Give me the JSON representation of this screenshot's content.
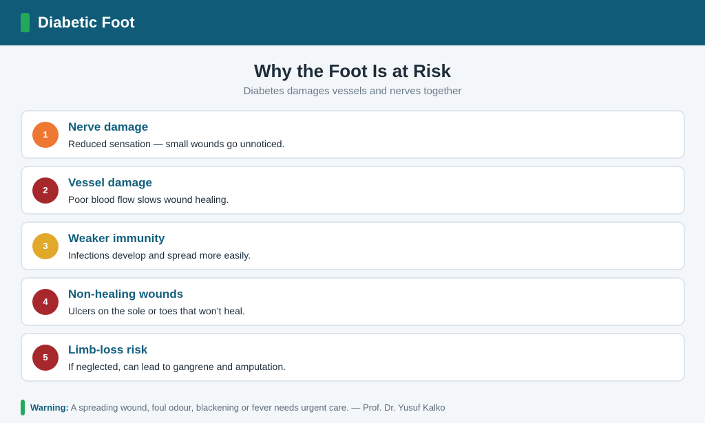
{
  "header": {
    "title": "Diabetic Foot"
  },
  "page": {
    "title": "Why the Foot Is at Risk",
    "subtitle": "Diabetes damages vessels and nerves together"
  },
  "risks": [
    {
      "number": "1",
      "title": "Nerve damage",
      "description": "Reduced sensation — small wounds go unnoticed.",
      "color": "#ee7731"
    },
    {
      "number": "2",
      "title": "Vessel damage",
      "description": "Poor blood flow slows wound healing.",
      "color": "#a7282c"
    },
    {
      "number": "3",
      "title": "Weaker immunity",
      "description": "Infections develop and spread more easily.",
      "color": "#e2a82a"
    },
    {
      "number": "4",
      "title": "Non-healing wounds",
      "description": "Ulcers on the sole or toes that won’t heal.",
      "color": "#a7282c"
    },
    {
      "number": "5",
      "title": "Limb-loss risk",
      "description": "If neglected, can lead to gangrene and amputation.",
      "color": "#a7282c"
    }
  ],
  "footer": {
    "label": "Warning:",
    "text": " A spreading wound, foul odour, blackening or fever needs urgent care. — Prof. Dr. Yusuf Kalko"
  },
  "colors": {
    "header_bg": "#0f5b78",
    "accent": "#22a95b",
    "title_blue": "#13607e"
  }
}
